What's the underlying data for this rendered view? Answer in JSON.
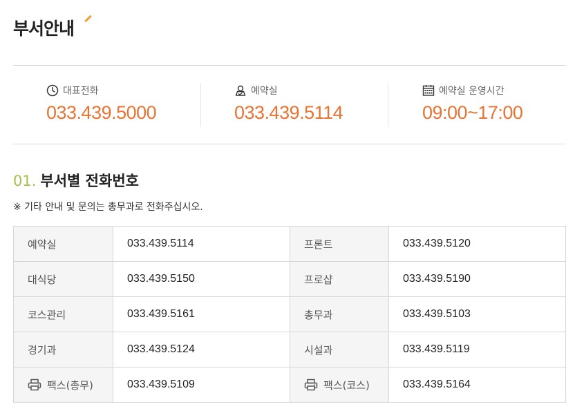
{
  "header": {
    "title": "부서안내"
  },
  "contacts": [
    {
      "icon": "clock-icon",
      "label": "대표전화",
      "value": "033.439.5000"
    },
    {
      "icon": "reservation-icon",
      "label": "예약실",
      "value": "033.439.5114"
    },
    {
      "icon": "calendar-icon",
      "label": "예약실 운영시간",
      "value": "09:00~17:00"
    }
  ],
  "section": {
    "number": "01.",
    "title": "부서별 전화번호",
    "note": "※ 기타 안내 및 문의는 총무과로 전화주십시오."
  },
  "departments": [
    {
      "left": {
        "name": "예약실",
        "phone": "033.439.5114"
      },
      "right": {
        "name": "프론트",
        "phone": "033.439.5120"
      }
    },
    {
      "left": {
        "name": "대식당",
        "phone": "033.439.5150"
      },
      "right": {
        "name": "프로샵",
        "phone": "033.439.5190"
      }
    },
    {
      "left": {
        "name": "코스관리",
        "phone": "033.439.5161"
      },
      "right": {
        "name": "총무과",
        "phone": "033.439.5103"
      }
    },
    {
      "left": {
        "name": "경기과",
        "phone": "033.439.5124"
      },
      "right": {
        "name": "시설과",
        "phone": "033.439.5119"
      }
    },
    {
      "left": {
        "name": "팩스(총무)",
        "phone": "033.439.5109",
        "icon": "fax-icon"
      },
      "right": {
        "name": "팩스(코스)",
        "phone": "033.439.5164",
        "icon": "fax-icon"
      }
    }
  ],
  "colors": {
    "accent": "#e87434",
    "section_number": "#a3c14a",
    "title_mark": "#f0a030"
  }
}
